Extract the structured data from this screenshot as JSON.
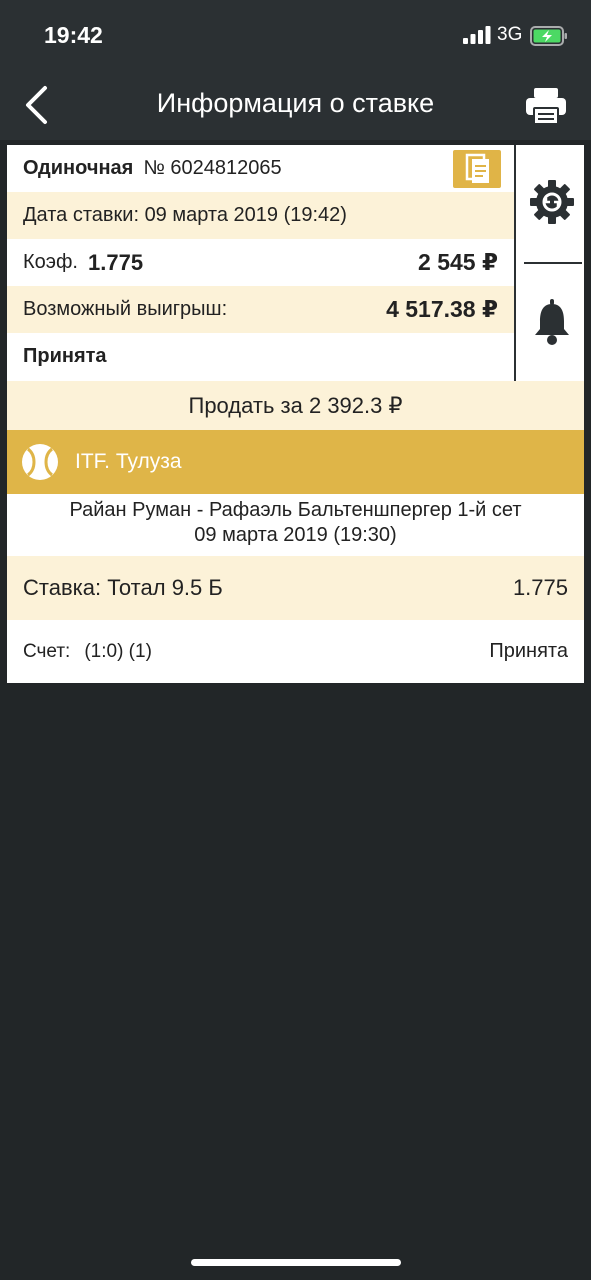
{
  "status_bar": {
    "time": "19:42",
    "network": "3G"
  },
  "nav": {
    "title": "Информация о ставке"
  },
  "bet_info": {
    "type": "Одиночная",
    "number": "№ 6024812065",
    "date": "Дата ставки: 09 марта 2019 (19:42)",
    "coef_label": "Коэф.",
    "coef_value": "1.775",
    "stake": "2 545 ₽",
    "possible_win_label": "Возможный выигрыш:",
    "possible_win": "4 517.38 ₽",
    "status": "Принята"
  },
  "sell_label": "Продать за 2 392.3 ₽",
  "event": {
    "league": "ITF. Тулуза",
    "match": "Райан Руман - Рафаэль Бальтеншпергер 1-й сет",
    "match_date": "09 марта 2019 (19:30)",
    "bet": "Ставка: Тотал 9.5 Б",
    "odd": "1.775",
    "score_label": "Счет:",
    "score": "(1:0) (1)",
    "status": "Принята"
  },
  "colors": {
    "accent": "#dfb548",
    "row_alt": "#fcf2d8",
    "header": "#2b3033",
    "background": "#222628"
  }
}
